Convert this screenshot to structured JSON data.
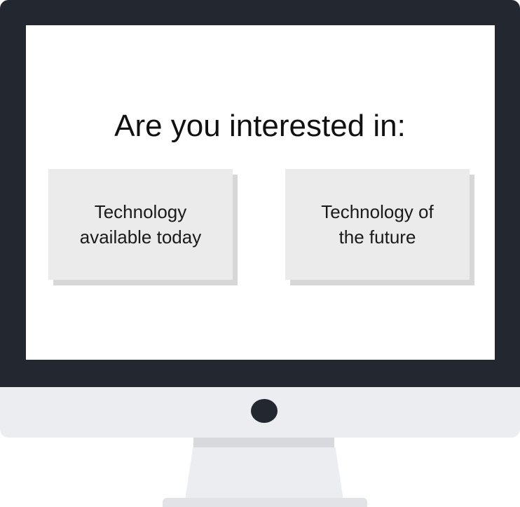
{
  "prompt": {
    "title": "Are you interested in:"
  },
  "options": [
    {
      "label": "Technology\navailable today"
    },
    {
      "label": "Technology of\nthe future"
    }
  ],
  "colors": {
    "bezel": "#23272f",
    "screen": "#ffffff",
    "card": "#ebebeb",
    "card_shadow": "#d7d7d7",
    "monitor_body": "#ecedf0"
  }
}
